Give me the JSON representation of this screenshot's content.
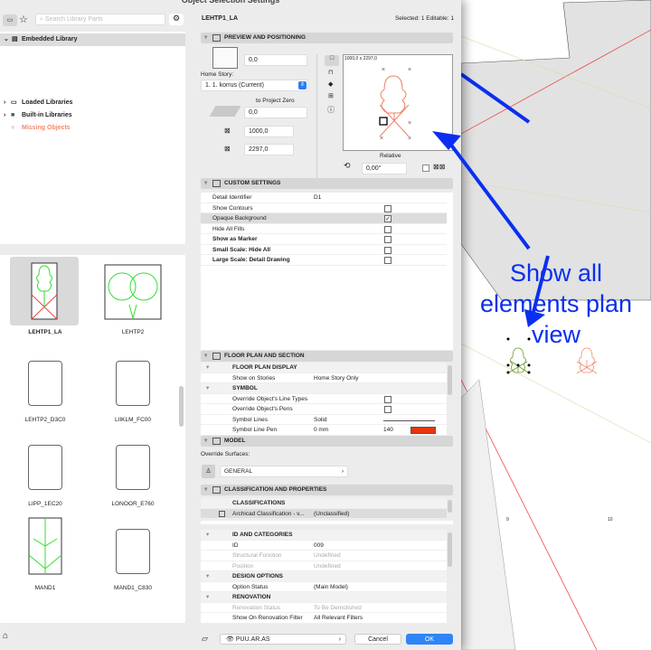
{
  "dialog": {
    "title": "Object Selection Settings"
  },
  "library": {
    "search_placeholder": "Search Library Parts",
    "tree": [
      {
        "label": "Embedded Library"
      },
      {
        "label": "Loaded Libraries"
      },
      {
        "label": "Built-in Libraries"
      },
      {
        "label": "Missing Objects"
      }
    ],
    "items": [
      {
        "label": "LEHTP1_LA",
        "selected": true
      },
      {
        "label": "LEHTP2"
      },
      {
        "label": "LEHTP2_D3C0"
      },
      {
        "label": "LIIKLM_FC00"
      },
      {
        "label": "LIPP_1EC20"
      },
      {
        "label": "LONOOR_E760"
      },
      {
        "label": "MAND1"
      },
      {
        "label": "MAND1_C830"
      }
    ]
  },
  "header": {
    "object_name": "LEHTP1_LA",
    "selection_info": "Selected: 1 Editable: 1"
  },
  "preview": {
    "title": "PREVIEW AND POSITIONING",
    "elevation": "0,0",
    "home_story_label": "Home Story:",
    "home_story": "1. 1. korrus (Current)",
    "to_project_zero": "to Project Zero",
    "project_zero_value": "0,0",
    "width": "1000,0",
    "height": "2297,0",
    "preview_size": "1000,0 x 2297,0",
    "relative": "Relative",
    "angle": "0,00°"
  },
  "custom": {
    "title": "CUSTOM SETTINGS",
    "rows": [
      {
        "label": "Detail Identifier",
        "value": "D1"
      },
      {
        "label": "Show Contours",
        "checked": false
      },
      {
        "label": "Opaque Background",
        "checked": true
      },
      {
        "label": "Hide All Fills",
        "checked": false
      },
      {
        "label": "Show as Marker",
        "checked": false
      },
      {
        "label": "Small Scale: Hide All",
        "checked": false
      },
      {
        "label": "Large Scale: Detail Drawing",
        "checked": false
      }
    ]
  },
  "floorplan": {
    "title": "FLOOR PLAN AND SECTION",
    "display_header": "FLOOR PLAN DISPLAY",
    "show_on_stories": "Show on Stories",
    "show_on_stories_value": "Home Story Only",
    "symbol_header": "SYMBOL",
    "override_line_types": "Override Object's Line Types",
    "override_pens": "Override Object's Pens",
    "symbol_lines": "Symbol Lines",
    "symbol_lines_value": "Solid",
    "symbol_line_pen": "Symbol Line Pen",
    "symbol_line_pen_value": "0 mm",
    "symbol_line_pen_num": "140",
    "pen_color": "#e8340f"
  },
  "model": {
    "title": "MODEL",
    "override_surfaces": "Override Surfaces:",
    "surface": "GENERAL"
  },
  "classification": {
    "title": "CLASSIFICATION AND PROPERTIES",
    "header": "CLASSIFICATIONS",
    "system": "Archicad Classification - v...",
    "value": "(Unclassified)"
  },
  "properties": {
    "id_header": "ID AND CATEGORIES",
    "id_label": "ID",
    "id_value": "009",
    "structural_function": "Structural Function",
    "structural_value": "Undefined",
    "position": "Position",
    "position_value": "Undefined",
    "design_header": "DESIGN OPTIONS",
    "option_status": "Option Status",
    "option_value": "(Main Model)",
    "renovation_header": "RENOVATION",
    "renovation_status": "Renovation Status",
    "renovation_value": "To Be Demolished",
    "renovation_filter": "Show On Renovation Filter",
    "renovation_filter_value": "All Relevant Filters"
  },
  "footer": {
    "layer": "PUU.AR.AS",
    "cancel": "Cancel",
    "ok": "OK"
  },
  "annotation": {
    "text_line1": "Show all",
    "text_line2": "elements plan",
    "text_line3": "view",
    "color": "#0a2ff0"
  },
  "plan": {
    "tree1_id": "9",
    "tree2_id": "10"
  }
}
